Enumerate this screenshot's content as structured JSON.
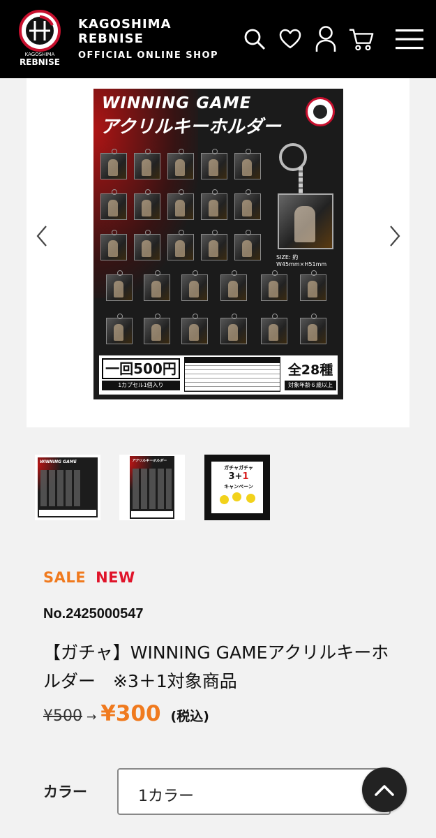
{
  "header": {
    "brand_line1": "KAGOSHIMA",
    "brand_line2": "REBNISE",
    "brand_line3": "OFFICIAL ONLINE SHOP",
    "logo_text_top": "KAGOSHIMA",
    "logo_text_bottom": "REBNISE",
    "icons": [
      "search-icon",
      "heart-icon",
      "user-icon",
      "cart-icon",
      "menu-icon"
    ],
    "colors": {
      "background": "#000000",
      "text": "#ffffff",
      "logo_accent": "#c8102e"
    }
  },
  "gallery": {
    "main_image": {
      "title_line1": "WINNING GAME",
      "title_line2": "アクリルキーホルダー",
      "size_text": "SIZE: 約W45mm×H51mm",
      "price_box": "一回500円",
      "price_sub": "1カプセル1個入り",
      "total_kinds": "全28種",
      "age_note": "対象年齢６歳以上"
    },
    "thumbnails": [
      {
        "title": "WINNING GAME"
      },
      {
        "title": "アクリルキーホルダー"
      },
      {
        "line1": "ガチャガチャ",
        "line2_a": "3",
        "line2_b": "+",
        "line2_c": "1",
        "line3": "キャンペーン"
      }
    ]
  },
  "product": {
    "badge_sale": "SALE",
    "badge_new": "NEW",
    "number": "No.2425000547",
    "name": "【ガチャ】WINNING GAMEアクリルキーホルダー　※3＋1対象商品",
    "old_price": "¥500",
    "arrow": "→",
    "new_price": "¥300",
    "tax_note": "(税込)",
    "colors": {
      "sale": "#f07a1e",
      "new": "#e0142a",
      "price": "#f07a1e"
    }
  },
  "options": {
    "color_label": "カラー",
    "color_value": "1カラー"
  }
}
